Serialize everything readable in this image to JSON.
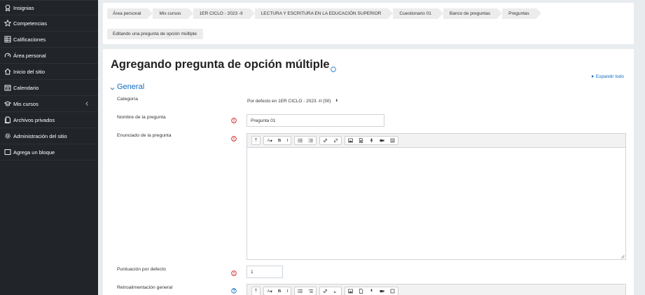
{
  "sidebar": {
    "items": [
      {
        "label": "Insignias",
        "icon": "badge-icon"
      },
      {
        "label": "Competencias",
        "icon": "star-icon"
      },
      {
        "label": "Calificaciones",
        "icon": "grades-table-icon"
      },
      {
        "label": "Área personal",
        "icon": "dashboard-gauge-icon"
      },
      {
        "label": "Inicio del sitio",
        "icon": "home-icon"
      },
      {
        "label": "Calendario",
        "icon": "calendar-icon"
      },
      {
        "label": "Mis cursos",
        "icon": "graduation-cap-icon"
      },
      {
        "label": "Archivos privados",
        "icon": "files-icon"
      },
      {
        "label": "Administración del sitio",
        "icon": "gear-icon"
      },
      {
        "label": "Agrega un bloque",
        "icon": "square-icon"
      }
    ],
    "mis_cursos_chevron": "chevron-left-icon",
    "bg_color": "#212529"
  },
  "breadcrumb": {
    "items": [
      "Área personal",
      "Mis cursos",
      "1ER CICLO - 2023 -II",
      "LECTURA Y ESCRITURA EN LA EDUCACIÓN SUPERIOR",
      "Cuestionario 01",
      "Banco de preguntas",
      "Preguntas"
    ],
    "current": "Editando una pregunta de opción múltiple"
  },
  "main": {
    "title": "Agregando pregunta de opción múltiple",
    "expand_all": "Expandir todo",
    "section_general": "General",
    "accent_color": "#0f6cbf",
    "required_color": "#c00"
  },
  "form": {
    "categoria_label": "Categoría",
    "categoria_value": "Por defecto en 1ER CICLO - 2023 -II (50)",
    "nombre_label": "Nombre de la pregunta",
    "nombre_value": "Pregunta 01",
    "enunciado_label": "Enunciado de la pregunta",
    "puntuacion_label": "Puntuación por defecto",
    "puntuacion_value": "1",
    "retro_label": "Retroalimentación general"
  },
  "editor_toolbar": {
    "collapse": "⤒",
    "font": "A",
    "bold": "B",
    "italic": "I"
  }
}
